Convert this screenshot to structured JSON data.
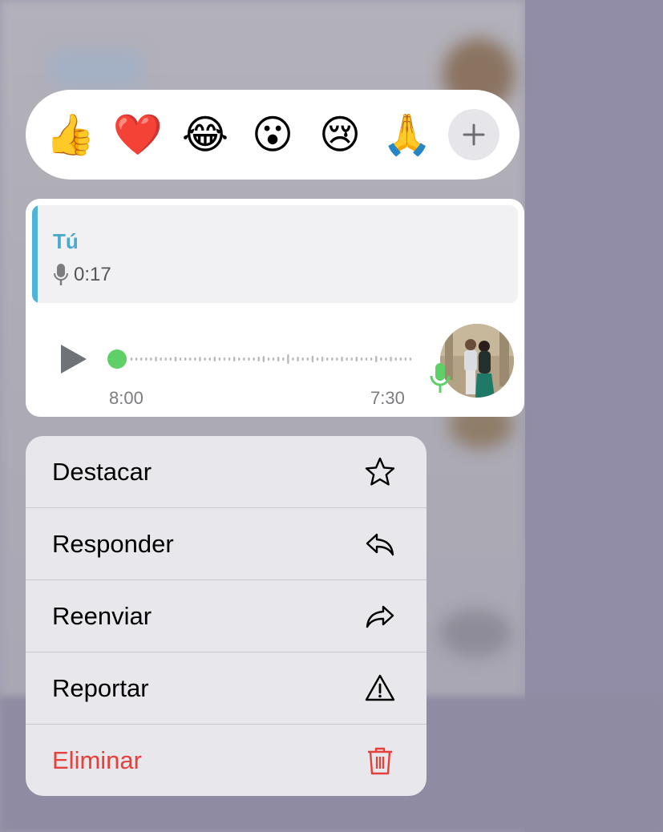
{
  "reactions": {
    "emojis": [
      {
        "char": "👍",
        "icon": "thumbs-up-icon"
      },
      {
        "char": "❤️",
        "icon": "heart-icon"
      },
      {
        "char": "😂",
        "icon": "tears-of-joy-icon"
      },
      {
        "char": "😮",
        "icon": "surprised-face-icon"
      },
      {
        "char": "😢",
        "icon": "crying-face-icon"
      },
      {
        "char": "🙏",
        "icon": "folded-hands-icon"
      }
    ],
    "more_icon": "plus-icon"
  },
  "message": {
    "quote": {
      "sender": "Tú",
      "duration": "0:17",
      "accent_color": "#4fb4d8"
    },
    "voice_note": {
      "elapsed": "8:00",
      "remaining": "7:30",
      "progress": 0,
      "progress_color": "#5fd068",
      "mic_color": "#5fd068"
    }
  },
  "menu": {
    "items": [
      {
        "label": "Destacar",
        "icon": "star-icon"
      },
      {
        "label": "Responder",
        "icon": "reply-icon"
      },
      {
        "label": "Reenviar",
        "icon": "forward-icon"
      },
      {
        "label": "Reportar",
        "icon": "warning-icon"
      },
      {
        "label": "Eliminar",
        "icon": "trash-icon",
        "destructive": true,
        "color": "#e5403a"
      }
    ]
  }
}
